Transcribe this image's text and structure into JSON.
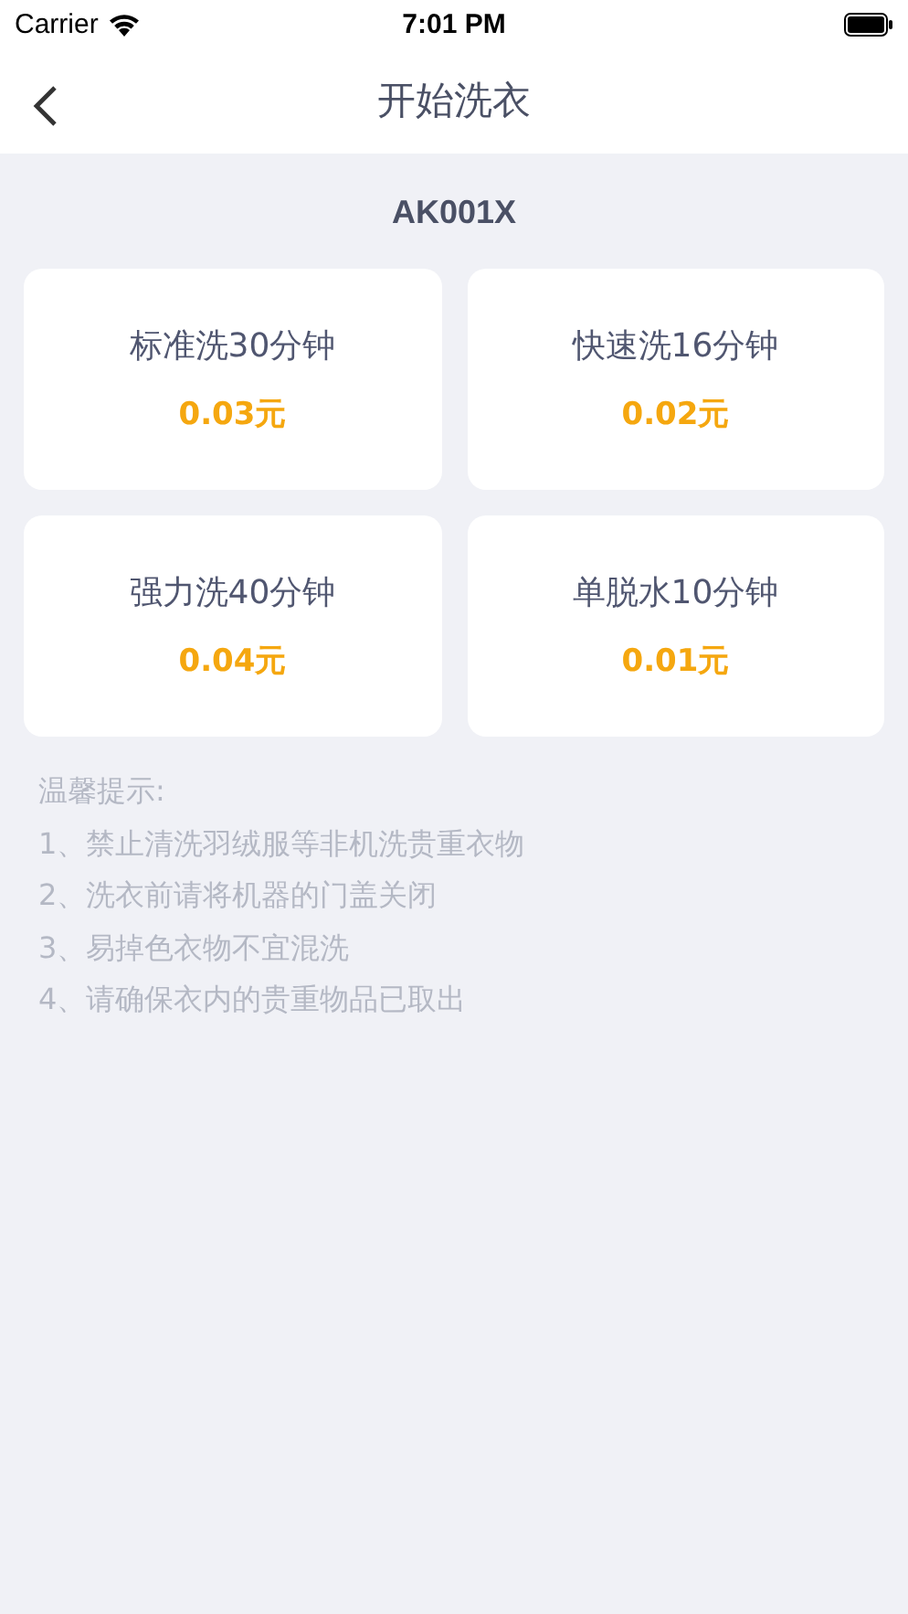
{
  "status_bar": {
    "carrier": "Carrier",
    "time": "7:01 PM"
  },
  "nav": {
    "title": "开始洗衣"
  },
  "device_id": "AK001X",
  "programs": [
    {
      "name": "标准洗30分钟",
      "price": "0.03元"
    },
    {
      "name": "快速洗16分钟",
      "price": "0.02元"
    },
    {
      "name": "强力洗40分钟",
      "price": "0.04元"
    },
    {
      "name": "单脱水10分钟",
      "price": "0.01元"
    }
  ],
  "tips": {
    "title": "温馨提示:",
    "items": [
      "1、禁止清洗羽绒服等非机洗贵重衣物",
      "2、洗衣前请将机器的门盖关闭",
      "3、易掉色衣物不宜混洗",
      "4、请确保衣内的贵重物品已取出"
    ]
  }
}
